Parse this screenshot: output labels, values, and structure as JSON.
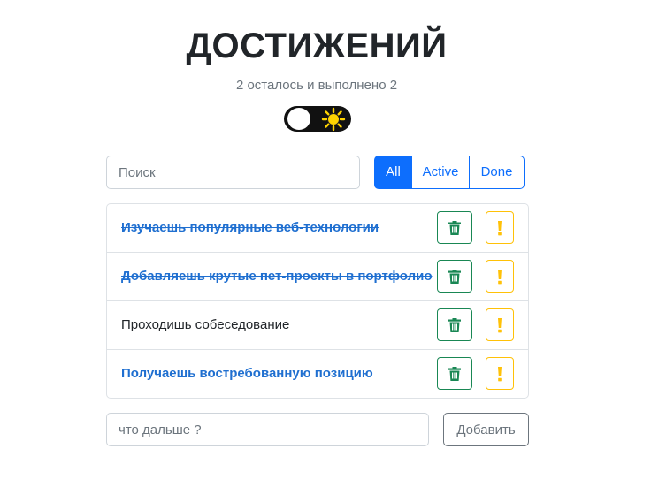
{
  "header": {
    "title": "ДОСТИЖЕНИЙ",
    "subtitle": "2 осталось и выполнено 2"
  },
  "theme_toggle": {
    "icon": "sun-icon",
    "state": "light"
  },
  "search": {
    "placeholder": "Поиск",
    "value": ""
  },
  "filters": {
    "selected": "All",
    "items": [
      {
        "label": "All",
        "active": true
      },
      {
        "label": "Active",
        "active": false
      },
      {
        "label": "Done",
        "active": false
      }
    ]
  },
  "todos": [
    {
      "label": "Изучаешь популярные веб-технологии",
      "done": true,
      "important": true
    },
    {
      "label": "Добавляешь крутые пет-проекты в портфолио",
      "done": true,
      "important": true
    },
    {
      "label": "Проходишь собеседование",
      "done": false,
      "important": false
    },
    {
      "label": "Получаешь востребованную позицию",
      "done": false,
      "important": true
    }
  ],
  "add_form": {
    "placeholder": "что дальше ?",
    "value": "",
    "button_label": "Добавить"
  },
  "colors": {
    "primary": "#0d6efd",
    "delete": "#198754",
    "important": "#ffc107",
    "important_text": "#1f6fd0",
    "secondary": "#6c757d"
  }
}
